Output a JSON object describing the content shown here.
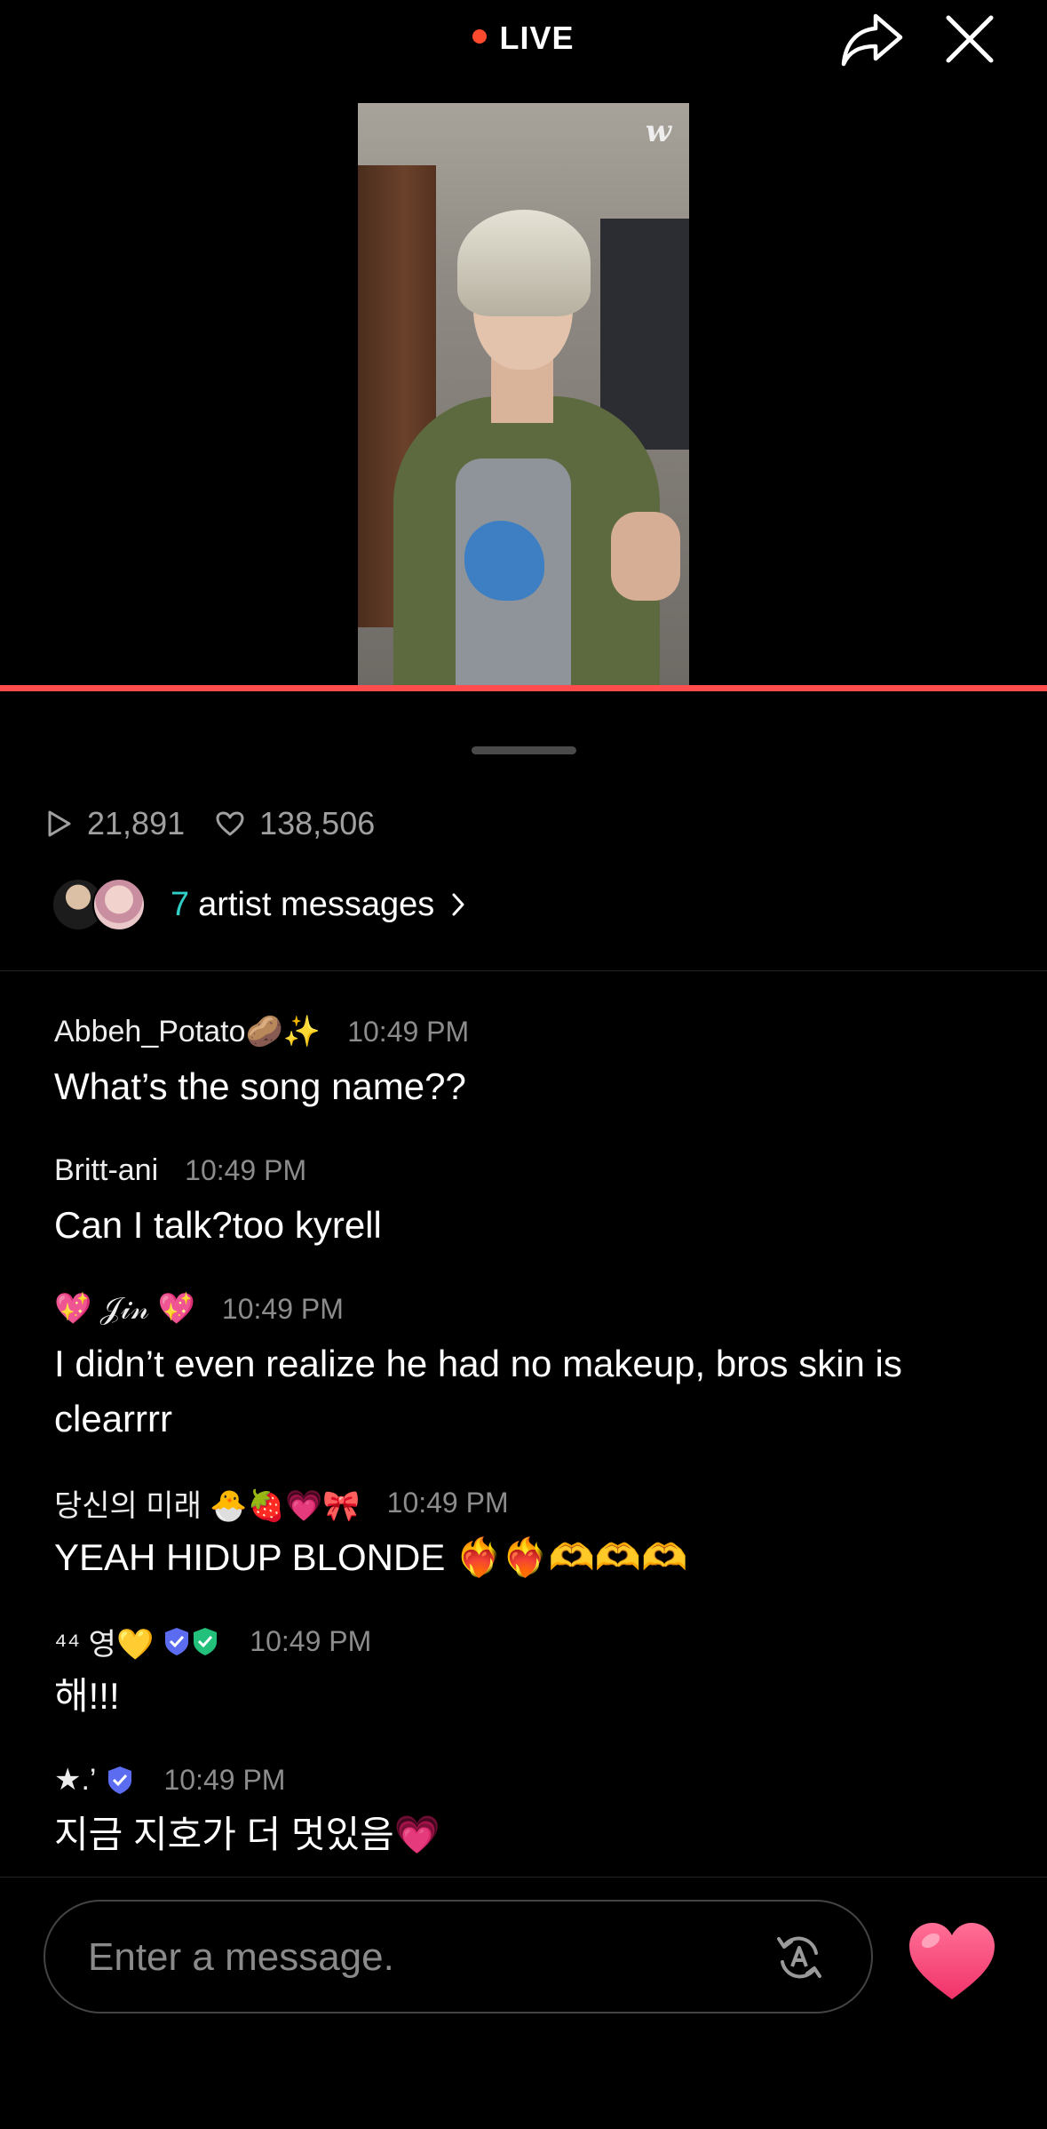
{
  "header": {
    "live_label": "LIVE",
    "live_color": "#ff4a2e"
  },
  "video": {
    "watermark": "w",
    "progress_color": "#ff4d4d"
  },
  "stats": {
    "views": "21,891",
    "likes": "138,506"
  },
  "artist_messages": {
    "count": "7",
    "label": "artist messages",
    "count_color": "#30d0c8"
  },
  "chat": [
    {
      "user": "Abbeh_Potato🥔✨",
      "time": "10:49 PM",
      "text": "What’s the song name??"
    },
    {
      "user": "Britt-ani",
      "time": "10:49 PM",
      "text": "Can I talk?too kyrell"
    },
    {
      "user": "💖 𝒥𝒾𝓃 💖",
      "time": "10:49 PM",
      "text": "I didn’t even realize he had no makeup, bros skin is clearrrr"
    },
    {
      "user": "당신의 미래 🐣🍓💗🎀",
      "time": "10:49 PM",
      "text": "YEAH HIDUP BLONDE ❤️‍🔥❤️‍🔥🫶🫶🫶"
    },
    {
      "user": "⁴⁴ 영💛",
      "time": "10:49 PM",
      "text": "해!!!"
    },
    {
      "user": "★.’",
      "time": "10:49 PM",
      "text": "지금 지호가 더 멋있음💗"
    }
  ],
  "composer": {
    "placeholder": "Enter a message."
  },
  "icons": {
    "share": "share-icon",
    "close": "close-icon",
    "play": "play-icon",
    "heart": "heart-outline-icon",
    "chevron": "chevron-right-icon",
    "translate": "translate-icon",
    "like": "heart-filled-icon"
  }
}
